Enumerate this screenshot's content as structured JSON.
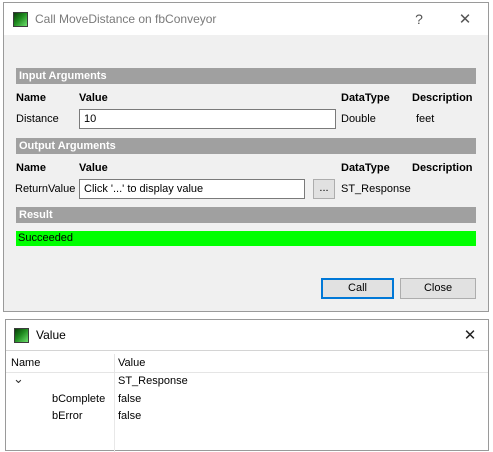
{
  "dialog": {
    "title": "Call MoveDistance on fbConveyor",
    "help_label": "?",
    "close_label": "✕",
    "input_section": "Input Arguments",
    "output_section": "Output Arguments",
    "result_section": "Result",
    "columns": {
      "name": "Name",
      "value": "Value",
      "datatype": "DataType",
      "description": "Description"
    },
    "input_row": {
      "name": "Distance",
      "value": "10",
      "datatype": "Double",
      "description": "feet"
    },
    "output_row": {
      "name": "ReturnValue",
      "value": "Click '...' to display value",
      "ellipsis": "...",
      "datatype": "ST_Response"
    },
    "result_text": "Succeeded",
    "result_color": "#00ff00",
    "call_label": "Call",
    "close_button_label": "Close"
  },
  "value_window": {
    "title": "Value",
    "close_label": "✕",
    "columns": {
      "name": "Name",
      "value": "Value"
    },
    "root": {
      "expander": "⌄",
      "value": "ST_Response"
    },
    "rows": [
      {
        "name": "bComplete",
        "value": "false"
      },
      {
        "name": "bError",
        "value": "false"
      }
    ]
  },
  "colors": {
    "section_header": "#a0a0a0",
    "accent": "#0078d7",
    "icon_green": "#1f8a1f"
  }
}
